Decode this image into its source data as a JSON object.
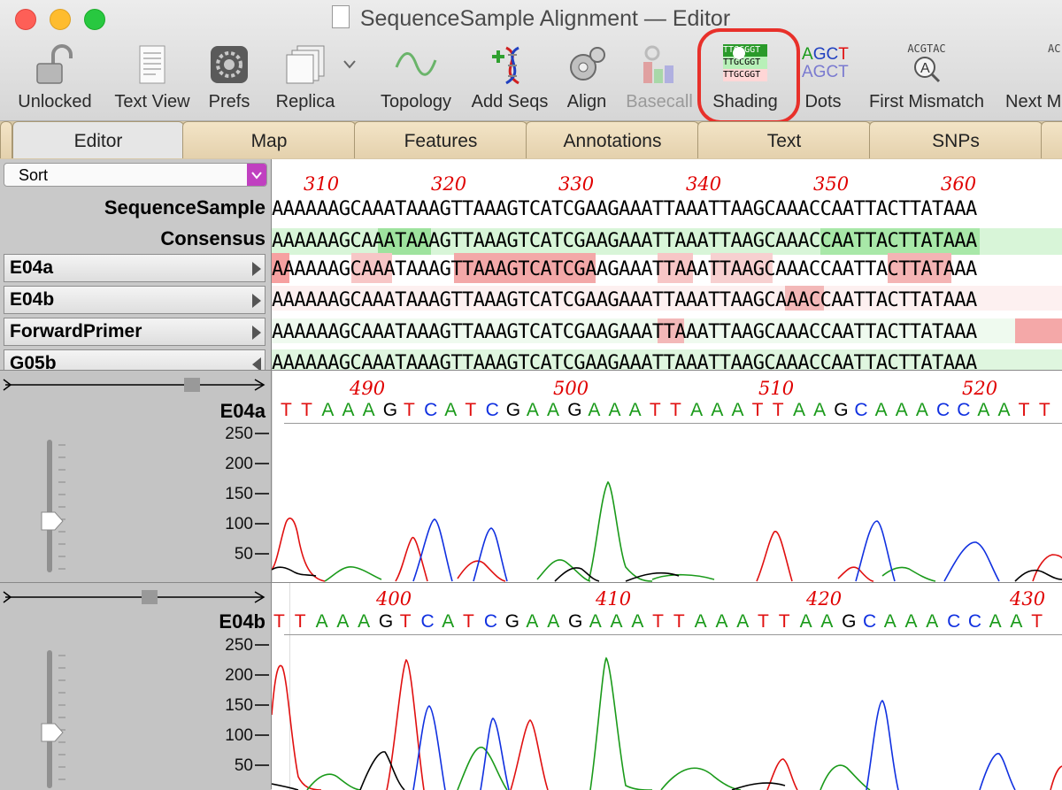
{
  "window": {
    "title": "SequenceSample Alignment — Editor"
  },
  "toolbar": {
    "unlocked": "Unlocked",
    "textview": "Text View",
    "prefs": "Prefs",
    "replica": "Replica",
    "topology": "Topology",
    "addseqs": "Add Seqs",
    "align": "Align",
    "basecall": "Basecall",
    "shading": "Shading",
    "dots": "Dots",
    "firstmismatch": "First Mismatch",
    "nextmismatch": "Next M",
    "shading_icon_text": [
      "TTGCGGT",
      "TTGCGGT",
      "TTGCGGT"
    ],
    "dots_icon_text": [
      "AGCT",
      "AGCT"
    ],
    "mismatch_icon_text": "ACGTAC",
    "next_icon_text": "AC"
  },
  "tabs": [
    "Editor",
    "Map",
    "Features",
    "Annotations",
    "Text",
    "SNPs"
  ],
  "sort": {
    "label": "Sort"
  },
  "alignment": {
    "ruler": [
      "310",
      "320",
      "330",
      "340",
      "350",
      "360"
    ],
    "rows": [
      {
        "name": "SequenceSample",
        "seq": "AAAAAAGCAAATAAAGTTAAAGTCATCGAAGAAATTAAATTAAGCAAACCAATTACTTATAAA"
      },
      {
        "name": "Consensus",
        "seq": "AAAAAAGCAAATAAAGTTAAAGTCATCGAAGAAATTAAATTAAGCAAACCAATTACTTATAAA"
      },
      {
        "name": "E04a",
        "seq": "AAAAAAGCAAATAAAGTTAAAGTCATCGAAGAAATTAAATTAAGCAAACCAATTACTTATAAA"
      },
      {
        "name": "E04b",
        "seq": "AAAAAAGCAAATAAAGTTAAAGTCATCGAAGAAATTAAATTAAGCAAACCAATTACTTATAAA"
      },
      {
        "name": "ForwardPrimer",
        "seq": "AAAAAAGCAAATAAAGTTAAAGTCATCGAAGAAATTAAATTAAGCAAACCAATTACTTATAAA"
      },
      {
        "name": "G05b",
        "seq": "AAAAAAGCAAATAAAGTTAAAGTCATCGAAGAAATTAAATTAAGCAAACCAATTACTTATAAA"
      }
    ]
  },
  "traces": [
    {
      "name": "E04a",
      "ruler": [
        "490",
        "500",
        "510",
        "520"
      ],
      "bases": "TTAAAGTCATCGAAGAAATTAAATTAAGCAAACCAATT",
      "yticks": [
        "250",
        "200",
        "150",
        "100",
        "50"
      ]
    },
    {
      "name": "E04b",
      "ruler": [
        "400",
        "410",
        "420",
        "430"
      ],
      "bases": "TTAAAGTCATCGAAGAAATTAAATTAAGCAAACCAAT",
      "yticks": [
        "250",
        "200",
        "150",
        "100",
        "50"
      ]
    }
  ],
  "colors": {
    "A": "#1a9a1a",
    "C": "#1030e0",
    "G": "#000000",
    "T": "#e01010",
    "highlight": "#e8302a"
  }
}
